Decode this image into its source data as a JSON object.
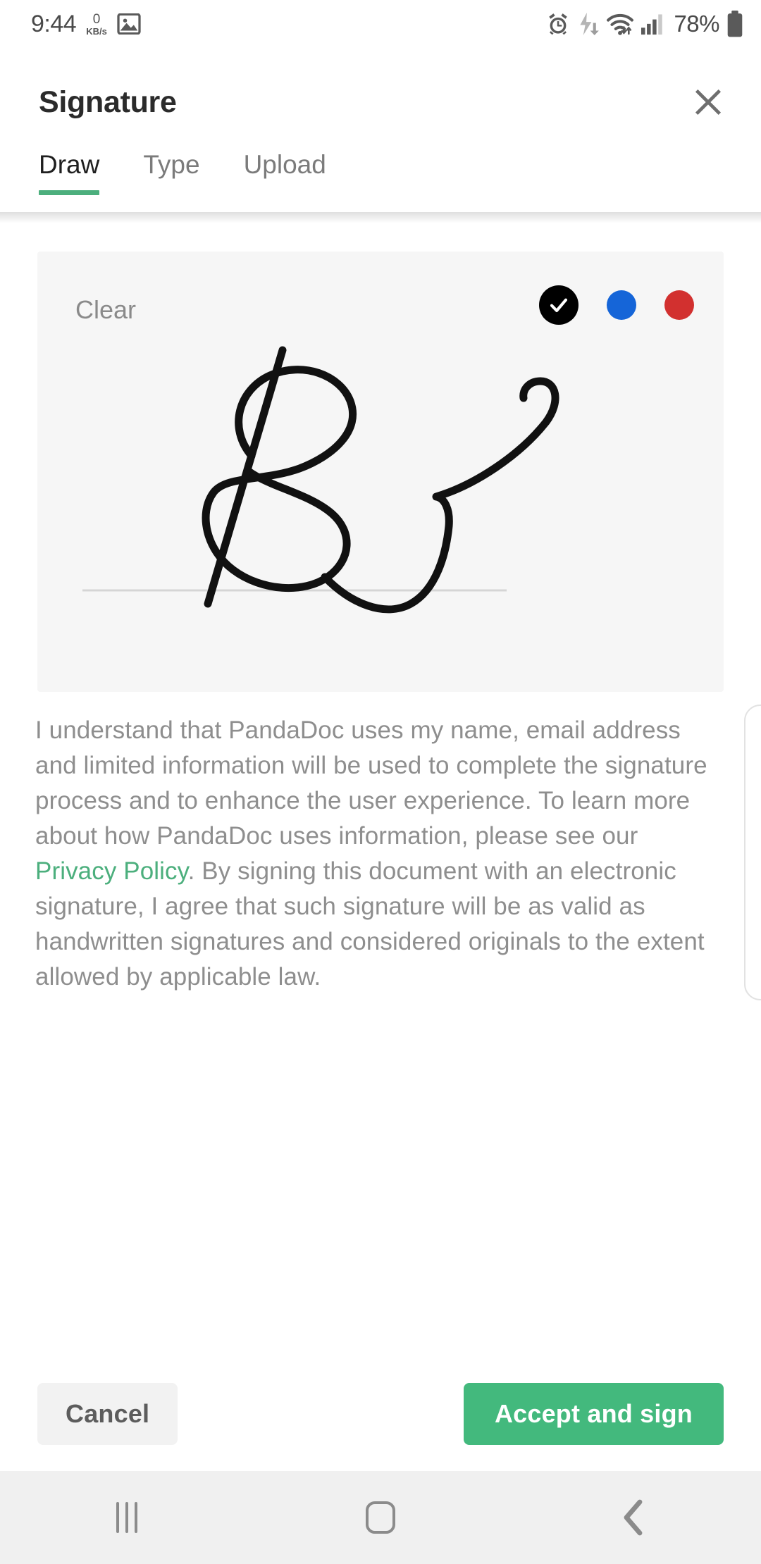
{
  "status_bar": {
    "time": "9:44",
    "net_speed_value": "0",
    "net_speed_unit": "KB/s",
    "icons": [
      "image-icon",
      "alarm-icon",
      "flash-download-icon",
      "wifi-icon",
      "signal-icon",
      "battery-icon"
    ],
    "battery_percent": "78%"
  },
  "header": {
    "title": "Signature",
    "close_label": "close-icon"
  },
  "tabs": [
    {
      "label": "Draw",
      "active": true
    },
    {
      "label": "Type",
      "active": false
    },
    {
      "label": "Upload",
      "active": false
    }
  ],
  "canvas": {
    "clear_label": "Clear",
    "colors": [
      {
        "name": "black",
        "hex": "#000000",
        "selected": true
      },
      {
        "name": "blue",
        "hex": "#1565d8",
        "selected": false
      },
      {
        "name": "red",
        "hex": "#d2302f",
        "selected": false
      }
    ],
    "baseline_color": "#d5d5d5",
    "stroke_color": "#111111",
    "card_background": "#f6f6f6"
  },
  "disclaimer": {
    "part1": "I understand that PandaDoc uses my name, email address and limited information will be used to complete the signature process and to enhance the user experience. To learn more about how PandaDoc uses information, please see our ",
    "link": "Privacy Policy",
    "part2": ". By signing this document with an electronic signature, I agree that such signature will be as valid as handwritten signatures and considered originals to the extent allowed by applicable law."
  },
  "footer": {
    "cancel_label": "Cancel",
    "accept_label": "Accept and sign",
    "accent_color": "#43b97d"
  },
  "navbar": {
    "recents_label": "recents-icon",
    "home_label": "home-icon",
    "back_label": "back-icon"
  }
}
